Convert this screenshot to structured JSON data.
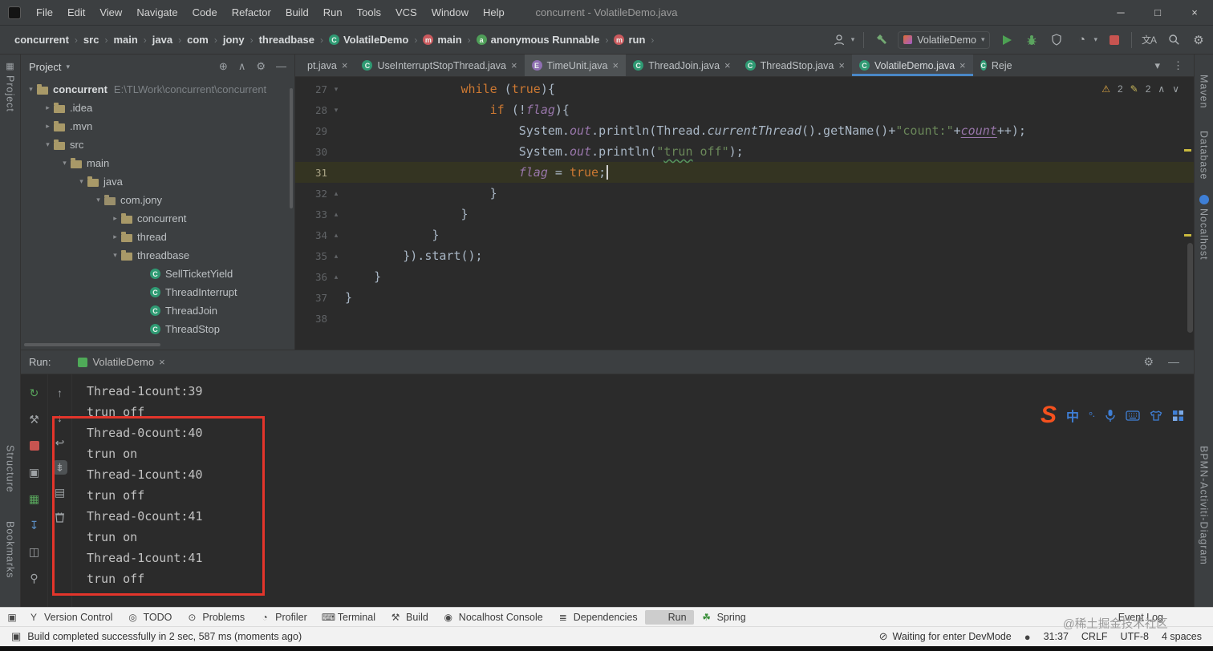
{
  "colors": {
    "accent_blue": "#4a88c7",
    "run_green": "#499c54",
    "stop_red": "#c75450",
    "annotation_red": "#e3352b",
    "warning_yellow": "#d9a343",
    "editor_bg": "#2b2b2b",
    "panel_bg": "#3c3f41"
  },
  "icons": {
    "gear": "⚙",
    "hide": "—",
    "caret_down": "▾",
    "more": "⋮",
    "up": "↑",
    "down": "↓",
    "rerun": "↻",
    "wrench": "⚒",
    "camera": "▣",
    "coverage": "▦",
    "import": "↧",
    "layout": "◫",
    "pin": "⚲",
    "softwrap": "↩",
    "scrollend": "⇟",
    "print": "▤",
    "clear": "▭",
    "locate": "⊕",
    "collapse_all": "∧",
    "profiler": "◔",
    "translate": "文A",
    "warning": "⚠",
    "pencil": "✎",
    "chev_up": "∧",
    "chev_down": "∨",
    "devmode": "⊘",
    "status_dot": "●",
    "build_status": "▣",
    "lang_cn": "中",
    "punct": "°·"
  },
  "window": {
    "title": "concurrent - VolatileDemo.java",
    "menus": [
      "File",
      "Edit",
      "View",
      "Navigate",
      "Code",
      "Refactor",
      "Build",
      "Run",
      "Tools",
      "VCS",
      "Window",
      "Help"
    ],
    "controls": {
      "minimize": "─",
      "maximize": "□",
      "close": "×"
    }
  },
  "navbar": {
    "breadcrumbs": [
      {
        "label": "concurrent",
        "ico": "bc-none"
      },
      {
        "label": "src",
        "ico": "bc-none"
      },
      {
        "label": "main",
        "ico": "bc-none"
      },
      {
        "label": "java",
        "ico": "bc-none"
      },
      {
        "label": "com",
        "ico": "bc-none"
      },
      {
        "label": "jony",
        "ico": "bc-none"
      },
      {
        "label": "threadbase",
        "ico": "bc-none"
      },
      {
        "label": "VolatileDemo",
        "ico": "bc-class"
      },
      {
        "label": "main",
        "ico": "bc-method"
      },
      {
        "label": "anonymous Runnable",
        "ico": "bc-anon"
      },
      {
        "label": "run",
        "ico": "bc-method"
      }
    ],
    "run_config": "VolatileDemo"
  },
  "tool_strips": {
    "left": [
      "Project",
      "Structure",
      "Bookmarks"
    ],
    "right": [
      "Maven",
      "Database",
      "Nocalhost",
      "BPMN-Activiti-Diagram"
    ]
  },
  "project": {
    "header": "Project",
    "tree": [
      {
        "label": "concurrent",
        "path": "E:\\TLWork\\concurrent\\concurrent",
        "cls": "ind0 root",
        "arrow": "▾",
        "ico": "ico-folder"
      },
      {
        "label": ".idea",
        "cls": "ind1",
        "arrow": "▸",
        "ico": "ico-folder"
      },
      {
        "label": ".mvn",
        "cls": "ind1",
        "arrow": "▸",
        "ico": "ico-folder"
      },
      {
        "label": "src",
        "cls": "ind1",
        "arrow": "▾",
        "ico": "ico-folder"
      },
      {
        "label": "main",
        "cls": "ind2",
        "arrow": "▾",
        "ico": "ico-folder"
      },
      {
        "label": "java",
        "cls": "ind3",
        "arrow": "▾",
        "ico": "ico-folder"
      },
      {
        "label": "com.jony",
        "cls": "ind4",
        "arrow": "▾",
        "ico": "ico-package"
      },
      {
        "label": "concurrent",
        "cls": "ind5",
        "arrow": "▸",
        "ico": "ico-folder"
      },
      {
        "label": "thread",
        "cls": "ind5",
        "arrow": "▸",
        "ico": "ico-folder"
      },
      {
        "label": "threadbase",
        "cls": "ind5",
        "arrow": "▾",
        "ico": "ico-folder"
      },
      {
        "label": "SellTicketYield",
        "cls": "ind6",
        "arrow": "",
        "ico": "ico-class"
      },
      {
        "label": "ThreadInterrupt",
        "cls": "ind6",
        "arrow": "",
        "ico": "ico-class"
      },
      {
        "label": "ThreadJoin",
        "cls": "ind6",
        "arrow": "",
        "ico": "ico-class"
      },
      {
        "label": "ThreadStop",
        "cls": "ind6",
        "arrow": "",
        "ico": "ico-class"
      }
    ]
  },
  "editor": {
    "tabs": [
      {
        "label": "pt.java",
        "cls": "",
        "ico": "ico-none",
        "close": "×"
      },
      {
        "label": "UseInterruptStopThread.java",
        "cls": "",
        "ico": "ico-class",
        "close": "×"
      },
      {
        "label": "TimeUnit.java",
        "cls": "hl",
        "ico": "ico-enum",
        "close": "×"
      },
      {
        "label": "ThreadJoin.java",
        "cls": "",
        "ico": "ico-class",
        "close": "×"
      },
      {
        "label": "ThreadStop.java",
        "cls": "",
        "ico": "ico-class",
        "close": "×"
      },
      {
        "label": "VolatileDemo.java",
        "cls": "sel",
        "ico": "ico-class",
        "close": "×"
      },
      {
        "label": "Reje",
        "cls": "cut",
        "ico": "ico-class",
        "close": ""
      }
    ],
    "inspections": {
      "warn_count": "2",
      "typo_count": "2"
    },
    "lines": [
      {
        "no": 27,
        "fold": "▾",
        "tokens": [
          [
            "sp",
            "                "
          ],
          [
            "kw",
            "while"
          ],
          [
            "sp",
            " ("
          ],
          [
            "kw",
            "true"
          ],
          [
            "sp",
            "){"
          ]
        ]
      },
      {
        "no": 28,
        "fold": "▾",
        "tokens": [
          [
            "sp",
            "                    "
          ],
          [
            "kw",
            "if"
          ],
          [
            "sp",
            " (!"
          ],
          [
            "fld",
            "flag"
          ],
          [
            "sp",
            "){"
          ]
        ]
      },
      {
        "no": 29,
        "fold": "",
        "tokens": [
          [
            "sp",
            "                        System."
          ],
          [
            "fld",
            "out"
          ],
          [
            "sp",
            ".println(Thread."
          ],
          [
            "sm",
            "currentThread"
          ],
          [
            "sp",
            "().getName()+"
          ],
          [
            "str",
            "\"count:\""
          ],
          [
            "sp",
            "+"
          ],
          [
            "fldu",
            "count"
          ],
          [
            "sp",
            "++);"
          ]
        ]
      },
      {
        "no": 30,
        "fold": "",
        "tokens": [
          [
            "sp",
            "                        System."
          ],
          [
            "fld",
            "out"
          ],
          [
            "sp",
            ".println("
          ],
          [
            "str",
            "\""
          ],
          [
            "strw",
            "trun"
          ],
          [
            "str",
            " off\""
          ],
          [
            "sp",
            ");"
          ]
        ]
      },
      {
        "no": 31,
        "fold": "",
        "current": true,
        "tokens": [
          [
            "sp",
            "                        "
          ],
          [
            "fld",
            "flag"
          ],
          [
            "sp",
            " = "
          ],
          [
            "kw",
            "true"
          ],
          [
            "sp",
            ";"
          ],
          [
            "caret",
            ""
          ]
        ]
      },
      {
        "no": 32,
        "fold": "▴",
        "tokens": [
          [
            "sp",
            "                    }"
          ]
        ]
      },
      {
        "no": 33,
        "fold": "▴",
        "tokens": [
          [
            "sp",
            "                }"
          ]
        ]
      },
      {
        "no": 34,
        "fold": "▴",
        "tokens": [
          [
            "sp",
            "            }"
          ]
        ]
      },
      {
        "no": 35,
        "fold": "▴",
        "tokens": [
          [
            "sp",
            "        }).start();"
          ]
        ]
      },
      {
        "no": 36,
        "fold": "▴",
        "tokens": [
          [
            "sp",
            "    }"
          ]
        ]
      },
      {
        "no": 37,
        "fold": "",
        "tokens": [
          [
            "sp",
            "}"
          ]
        ]
      },
      {
        "no": 38,
        "fold": "",
        "tokens": [
          [
            "sp",
            ""
          ]
        ]
      }
    ]
  },
  "run": {
    "label": "Run:",
    "tab": "VolatileDemo",
    "console": [
      "Thread-1count:39",
      "trun off",
      "Thread-0count:40",
      "trun on",
      "Thread-1count:40",
      "trun off",
      "Thread-0count:41",
      "trun on",
      "Thread-1count:41",
      "trun off"
    ]
  },
  "toolbar_bottom": {
    "items": [
      {
        "label": "Version Control",
        "ico": "vcs",
        "cls": ""
      },
      {
        "label": "TODO",
        "ico": "todo",
        "cls": ""
      },
      {
        "label": "Problems",
        "ico": "problems",
        "cls": ""
      },
      {
        "label": "Profiler",
        "ico": "profiler",
        "cls": ""
      },
      {
        "label": "Terminal",
        "ico": "terminal",
        "cls": ""
      },
      {
        "label": "Build",
        "ico": "build",
        "cls": ""
      },
      {
        "label": "Nocalhost Console",
        "ico": "nocalhost",
        "cls": ""
      },
      {
        "label": "Dependencies",
        "ico": "dependencies",
        "cls": ""
      },
      {
        "label": "Run",
        "ico": "run",
        "cls": "sel"
      },
      {
        "label": "Spring",
        "ico": "spring",
        "cls": ""
      }
    ],
    "event_log": "Event Log"
  },
  "statusbar": {
    "message": "Build completed successfully in 2 sec, 587 ms (moments ago)",
    "devmode": "Waiting for enter DevMode",
    "position": "31:37",
    "line_ending": "CRLF",
    "encoding": "UTF-8",
    "indent": "4 spaces"
  },
  "overlays": {
    "watermark": "@稀土掘金技术社区",
    "ime_logo": "S"
  }
}
